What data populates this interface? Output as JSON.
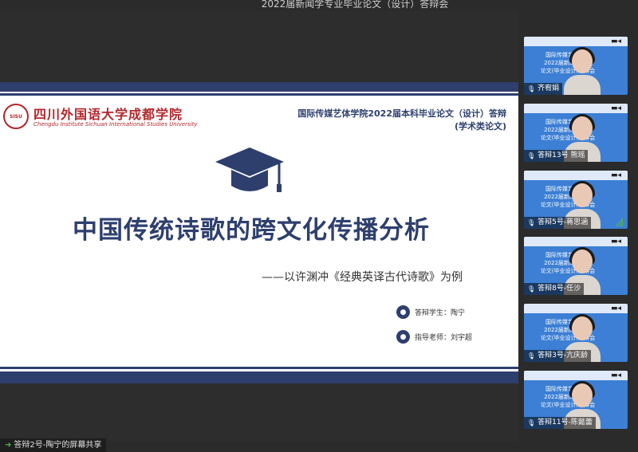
{
  "window_title": "2022届新闻学专业毕业论文（设计）答辩会",
  "slide": {
    "logo_cn": "四川外国语大学成都学院",
    "logo_en": "Chengdu Institute Sichuan International Studies University",
    "logo_seal": "SISU",
    "header_line1": "国际传媒艺体学院2022届本科毕业论文（设计）答辩",
    "header_line2": "(学术类论文)",
    "title": "中国传统诗歌的跨文化传播分析",
    "subtitle": "——以许渊冲《经典英译古代诗歌》为例",
    "student_label": "答辩学生：陶宁",
    "advisor_label": "指导老师：刘宇超"
  },
  "share_label": "答辩2号-陶宁的屏幕共享",
  "thumb_slide_text": [
    "国际传媒艺体学院",
    "2022届新闻学专业",
    "论文(毕业设计)答辩会"
  ],
  "participants": [
    {
      "name": "齐宥娟",
      "icon": "mic-icon"
    },
    {
      "name": "答辩13号 熊瑶",
      "icon": "mic-muted-icon"
    },
    {
      "name": "答辩5号-蒋思涵",
      "icon": "mic-muted-icon"
    },
    {
      "name": "答辩8号-任沙",
      "icon": "mic-muted-icon"
    },
    {
      "name": "答辩3号-亢庆龄",
      "icon": "mic-muted-icon"
    },
    {
      "name": "答辩11号-陈懿蕾",
      "icon": "mic-muted-icon"
    }
  ],
  "colors": {
    "accent": "#2e3f6e",
    "school_red": "#b3262c",
    "thumb_bg": "#3c7fd4"
  }
}
